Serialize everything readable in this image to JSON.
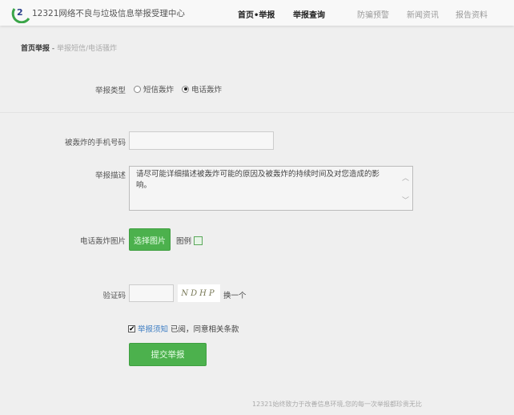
{
  "header": {
    "site_title": "12321网络不良与垃圾信息举报受理中心",
    "nav": [
      {
        "label": "首页•举报"
      },
      {
        "label": "举报查询"
      },
      {
        "label": "防骗预警"
      },
      {
        "label": "新闻资讯"
      },
      {
        "label": "报告资料"
      }
    ]
  },
  "breadcrumb": {
    "home": "首页举报",
    "separator": " - ",
    "current": "举报短信/电话骚炸"
  },
  "form": {
    "type_label": "举报类型",
    "type_options": [
      {
        "label": "短信轰炸",
        "selected": false
      },
      {
        "label": "电话轰炸",
        "selected": true
      }
    ],
    "phone_label": "被轰炸的手机号码",
    "phone_value": "",
    "desc_label": "举报描述",
    "desc_value": "请尽可能详细描述被轰炸可能的原因及被轰炸的持续时间及对您造成的影响。",
    "image_label": "电话轰炸图片",
    "choose_image": "选择图片",
    "example_label": "图例",
    "captcha_label": "验证码",
    "captcha_value": "",
    "captcha_text": "NDHP",
    "refresh_captcha": "换一个",
    "agree_checked": true,
    "agree_link": "举报须知",
    "agree_text": "已阅，同意相关条款",
    "submit": "提交举报"
  },
  "footer": {
    "text": "12321始终致力于改善信息环境,您的每一次举报都珍贵无比"
  },
  "colors": {
    "green": "#4cb14d",
    "link": "#3a7bc2"
  }
}
